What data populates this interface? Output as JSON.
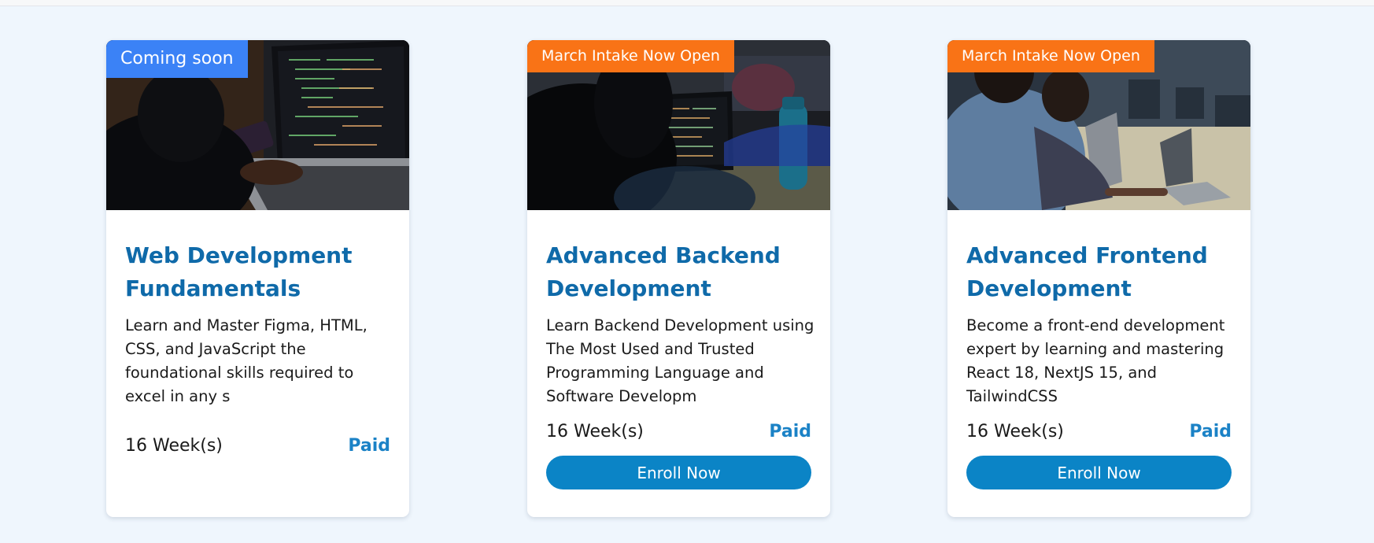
{
  "colors": {
    "page_background": "#eff6fd",
    "badge_coming_soon": "#3b82f6",
    "badge_intake": "#f97316",
    "title": "#0f6aa9",
    "price": "#1b82c6",
    "button": "#0b84c6"
  },
  "courses": [
    {
      "badge": "Coming soon",
      "image_icon": "laptop-coding-photo",
      "title": "Web Development Fundamentals",
      "description": "Learn and Master Figma, HTML, CSS, and JavaScript the foundational skills required to excel in any s",
      "duration": "16 Week(s)",
      "price": "Paid",
      "cta": ""
    },
    {
      "badge": "March Intake Now Open",
      "image_icon": "classroom-code-monitor-photo",
      "title": "Advanced Backend Development",
      "description": "Learn Backend Development using The Most Used and Trusted Programming Language and Software Developm",
      "duration": "16 Week(s)",
      "price": "Paid",
      "cta": "Enroll Now"
    },
    {
      "badge": "March Intake Now Open",
      "image_icon": "students-laptops-photo",
      "title": "Advanced Frontend Development",
      "description": "Become a front-end development expert by learning and mastering React 18, NextJS 15, and TailwindCSS",
      "duration": "16 Week(s)",
      "price": "Paid",
      "cta": "Enroll Now"
    }
  ]
}
